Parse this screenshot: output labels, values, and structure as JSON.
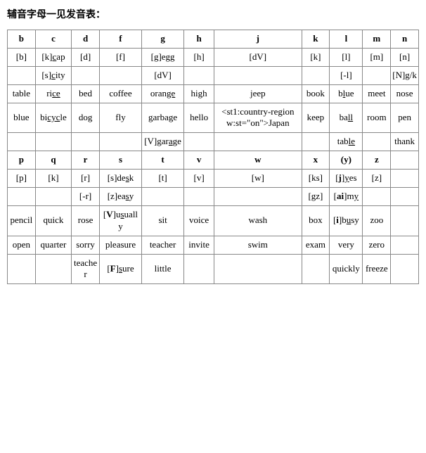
{
  "title": "辅音字母一见发音表：",
  "columns": [
    "b",
    "c",
    "d",
    "f",
    "g",
    "h",
    "j",
    "k",
    "l",
    "m",
    "n"
  ],
  "rows1": [
    {
      "b": "[b]",
      "c_html": "[k]<u>c</u>ap",
      "d": "[d]",
      "f": "[f]",
      "g_html": "[g]e<u>gg</u>",
      "h": "[h]",
      "j": "[dV]",
      "k": "[k]",
      "l": "[l]",
      "m": "[m]",
      "n": "[n]"
    },
    {
      "b": "",
      "c_html": "[s]<u>c</u>ity",
      "d": "",
      "f": "",
      "g": "[dV]",
      "h": "",
      "j": "",
      "k": "",
      "l": "[-l]",
      "m": "",
      "n": "[N]g/k"
    },
    {
      "b": "table",
      "c_html": "ri<u>ce</u>",
      "d": "bed",
      "f": "coffee",
      "g_html": "oran<u>ge</u>",
      "h": "high",
      "j": "jeep",
      "k": "book",
      "l_html": "b<u>l</u>ue",
      "m": "meet",
      "n": "nose"
    },
    {
      "b": "blue",
      "c_html": "bi<u>cyc</u>le",
      "d": "dog",
      "f": "fly",
      "g_html": "garba<u>g</u>e",
      "h": "hello",
      "j": "<st1:country-region w:st=\"on\">Japan",
      "k": "keep",
      "l_html": "ba<u>ll</u>",
      "m": "room",
      "n": "pen"
    },
    {
      "b": "",
      "c": "",
      "d": "",
      "f": "",
      "g_html": "[V]gar<u>a</u>ge",
      "h": "",
      "j": "",
      "k": "",
      "l_html": "tab<u>le</u>",
      "m": "",
      "n": "thank"
    }
  ],
  "columns2": [
    "p",
    "q",
    "r",
    "s",
    "t",
    "v",
    "w",
    "x",
    "(y)",
    "z",
    ""
  ],
  "rows2": [
    {
      "p": "[p]",
      "q": "[k]",
      "r": "[r]",
      "s_html": "[s]de<u>s</u>k",
      "t": "[t]",
      "v": "[v]",
      "w": "[w]",
      "x": "[ks]",
      "y_html": "[<b>j</b>]<u>y</u>es",
      "z": "[z]",
      "n": ""
    },
    {
      "p": "",
      "q": "",
      "r": "[-r]",
      "s_html": "[z]ea<u>s</u>y",
      "t": "",
      "v": "",
      "w": "",
      "x": "[gz]",
      "y_html": "[<b>ai</b>]m<u>y</u>",
      "z": "",
      "n": ""
    },
    {
      "p": "pencil",
      "q": "quick",
      "r": "rose",
      "s_html": "[<b>V</b>]u<u>s</u>ually",
      "t": "sit",
      "v": "voice",
      "w": "wash",
      "x": "box",
      "y_html": "[<b>i</b>]b<u>u</u>sy",
      "z": "zoo",
      "n": ""
    },
    {
      "p": "open",
      "q": "quarter",
      "r": "sorry",
      "s": "pleasure",
      "t": "teacher",
      "v": "invite",
      "w": "swim",
      "x": "exam",
      "y": "very",
      "z": "zero",
      "n": ""
    },
    {
      "p": "",
      "q": "",
      "r": "teacher",
      "s_html": "[<b>F</b>]<u>s</u>ure",
      "t": "little",
      "v": "",
      "w": "",
      "x": "",
      "y": "quickly",
      "z": "freeze",
      "n": ""
    }
  ],
  "chart_data": {
    "type": "table",
    "title": "辅音字母一见发音表",
    "columns": [
      "b",
      "c",
      "d",
      "f",
      "g",
      "h",
      "j",
      "k",
      "l",
      "m",
      "n",
      "p",
      "q",
      "r",
      "s",
      "t",
      "v",
      "w",
      "x",
      "(y)",
      "z"
    ],
    "phonetics": {
      "b": [
        "[b]"
      ],
      "c": [
        "[k]",
        "[s]"
      ],
      "d": [
        "[d]"
      ],
      "f": [
        "[f]"
      ],
      "g": [
        "[g]",
        "[dV]",
        "[V]"
      ],
      "h": [
        "[h]"
      ],
      "j": [
        "[dV]"
      ],
      "k": [
        "[k]"
      ],
      "l": [
        "[l]",
        "[-l]"
      ],
      "m": [
        "[m]"
      ],
      "n": [
        "[n]",
        "[N]"
      ],
      "p": [
        "[p]"
      ],
      "q": [
        "[k]"
      ],
      "r": [
        "[r]",
        "[-r]"
      ],
      "s": [
        "[s]",
        "[z]",
        "[V]",
        "[F]"
      ],
      "t": [
        "[t]"
      ],
      "v": [
        "[v]"
      ],
      "w": [
        "[w]"
      ],
      "x": [
        "[ks]",
        "[gz]"
      ],
      "y": [
        "[j]",
        "[ai]",
        "[i]"
      ],
      "z": [
        "[z]"
      ]
    },
    "examples": {
      "b": [
        "table",
        "blue"
      ],
      "c": [
        "cap",
        "city",
        "rice",
        "bicycle"
      ],
      "d": [
        "bed",
        "dog"
      ],
      "f": [
        "coffee",
        "fly"
      ],
      "g": [
        "egg",
        "orange",
        "garbage",
        "garage"
      ],
      "h": [
        "high",
        "hello"
      ],
      "j": [
        "jeep",
        "Japan"
      ],
      "k": [
        "book",
        "keep"
      ],
      "l": [
        "blue",
        "ball",
        "table"
      ],
      "m": [
        "meet",
        "room"
      ],
      "n": [
        "nose",
        "pen",
        "thank"
      ],
      "p": [
        "pencil",
        "open"
      ],
      "q": [
        "quick",
        "quarter"
      ],
      "r": [
        "rose",
        "sorry",
        "teacher"
      ],
      "s": [
        "desk",
        "easy",
        "usually",
        "pleasure",
        "sure"
      ],
      "t": [
        "sit",
        "teacher",
        "little"
      ],
      "v": [
        "voice",
        "invite"
      ],
      "w": [
        "wash",
        "swim"
      ],
      "x": [
        "box",
        "exam"
      ],
      "y": [
        "yes",
        "my",
        "busy",
        "very",
        "quickly"
      ],
      "z": [
        "zoo",
        "zero",
        "freeze"
      ]
    }
  }
}
